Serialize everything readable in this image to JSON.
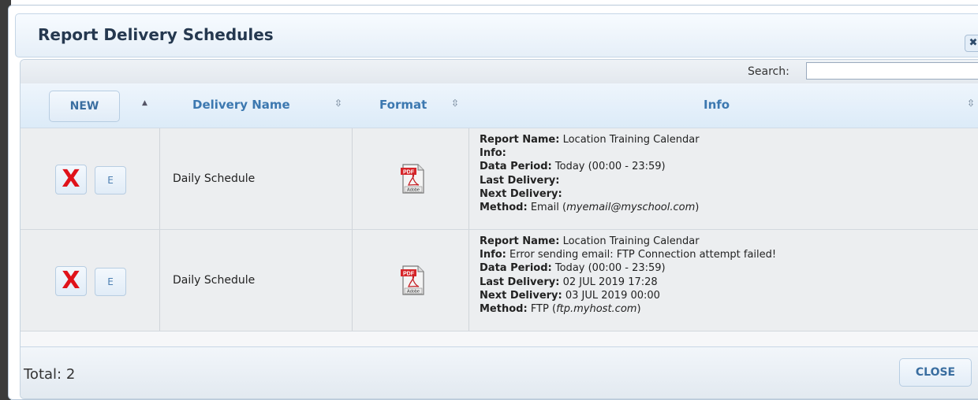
{
  "dialog": {
    "title": "Report Delivery Schedules",
    "close_icon": "close-icon"
  },
  "search": {
    "label": "Search:",
    "value": ""
  },
  "table": {
    "new_label": "NEW",
    "columns": [
      "Delivery Name",
      "Format",
      "Info"
    ],
    "rows": [
      {
        "delivery_name": "Daily Schedule",
        "format_icon": "pdf-icon",
        "info": {
          "report_name_label": "Report Name:",
          "report_name": "Location Training Calendar",
          "info_label": "Info:",
          "info": "",
          "data_period_label": "Data Period:",
          "data_period": "Today (00:00 - 23:59)",
          "last_delivery_label": "Last Delivery:",
          "last_delivery": "",
          "next_delivery_label": "Next Delivery:",
          "next_delivery": "",
          "method_label": "Method:",
          "method": "Email",
          "method_target": "myemail@myschool.com"
        }
      },
      {
        "delivery_name": "Daily Schedule",
        "format_icon": "pdf-icon",
        "info": {
          "report_name_label": "Report Name:",
          "report_name": "Location Training Calendar",
          "info_label": "Info:",
          "info": "Error sending email: FTP Connection attempt failed!",
          "data_period_label": "Data Period:",
          "data_period": "Today (00:00 - 23:59)",
          "last_delivery_label": "Last Delivery:",
          "last_delivery": "02 JUL 2019 17:28",
          "next_delivery_label": "Next Delivery:",
          "next_delivery": "03 JUL 2019 00:00",
          "method_label": "Method:",
          "method": "FTP",
          "method_target": "ftp.myhost.com"
        }
      }
    ],
    "row_actions": {
      "delete_glyph": "X",
      "edit_label": "E"
    }
  },
  "footer": {
    "total_label": "Total: 2",
    "close_label": "CLOSE"
  },
  "colors": {
    "header_text": "#3c78b0",
    "delete_red": "#e0121a",
    "title_text": "#25384f"
  }
}
